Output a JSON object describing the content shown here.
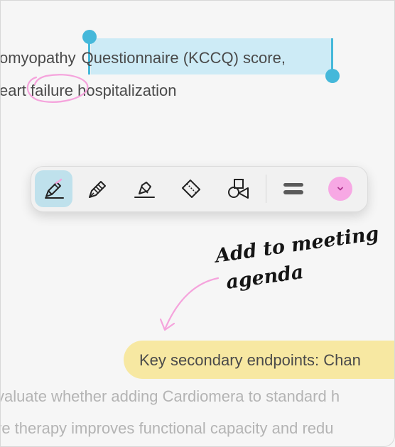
{
  "document": {
    "line1_prefix": "omyopathy",
    "line1_selected": "Questionnaire (KCCQ) score,",
    "line2_a": "eart",
    "line2_b": "failure",
    "line2_c": "hospitalization",
    "annotation_line1": "Add to meeting",
    "annotation_line2": "agenda",
    "highlighted_text": "Key secondary endpoints: Chan",
    "faded_line1": "valuate whether adding Cardiomera to standard h",
    "faded_line2": "re therapy improves functional capacity and redu"
  },
  "toolbar": {
    "tools": [
      {
        "name": "pen-highlighter",
        "active": true
      },
      {
        "name": "fountain-pen",
        "active": false
      },
      {
        "name": "marker",
        "active": false
      },
      {
        "name": "eraser",
        "active": false
      },
      {
        "name": "shapes",
        "active": false
      },
      {
        "name": "line-thickness",
        "active": false
      }
    ],
    "color_swatch": "#f7a8e4"
  },
  "colors": {
    "selection": "#cdebf6",
    "selection_handle": "#45b8da",
    "highlight": "#f7e8a2",
    "ink_pink": "#f5a3dc"
  }
}
